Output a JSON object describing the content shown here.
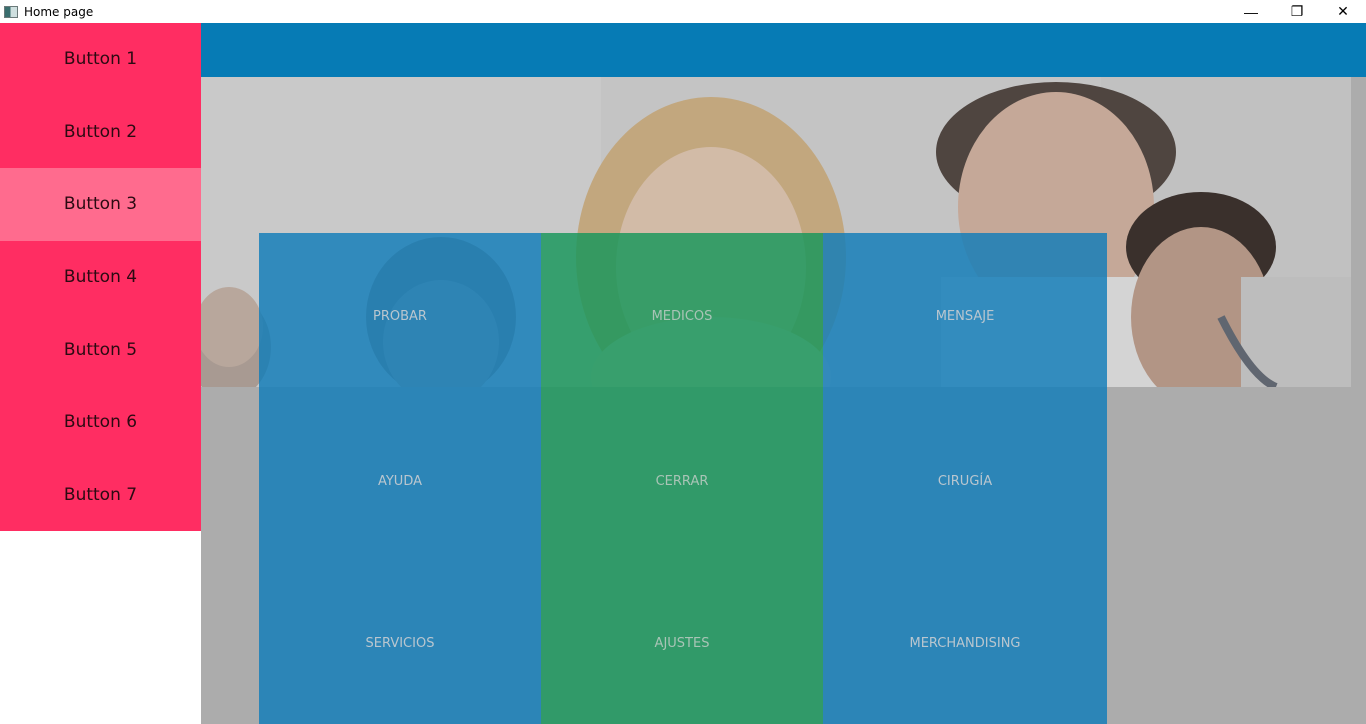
{
  "window": {
    "title": "Home page",
    "controls": [
      "—",
      "❐",
      "✕"
    ]
  },
  "sidebar": {
    "items": [
      {
        "label": "Button 1"
      },
      {
        "label": "Button 2"
      },
      {
        "label": "Button 3"
      },
      {
        "label": "Button 4"
      },
      {
        "label": "Button 5"
      },
      {
        "label": "Button 6"
      },
      {
        "label": "Button 7"
      }
    ],
    "color": "#ff2d62",
    "hover_color": "#ff6b8e"
  },
  "header": {
    "color": "#067bb5"
  },
  "tiles": [
    {
      "label": "PROBAR",
      "color": "blue"
    },
    {
      "label": "MEDICOS",
      "color": "green"
    },
    {
      "label": "MENSAJE",
      "color": "blue"
    },
    {
      "label": "AYUDA",
      "color": "blue"
    },
    {
      "label": "CERRAR",
      "color": "green"
    },
    {
      "label": "CIRUGÍA",
      "color": "blue"
    },
    {
      "label": "SERVICIOS",
      "color": "blue"
    },
    {
      "label": "AJUSTES",
      "color": "green"
    },
    {
      "label": "MERCHANDISING",
      "color": "blue"
    }
  ]
}
